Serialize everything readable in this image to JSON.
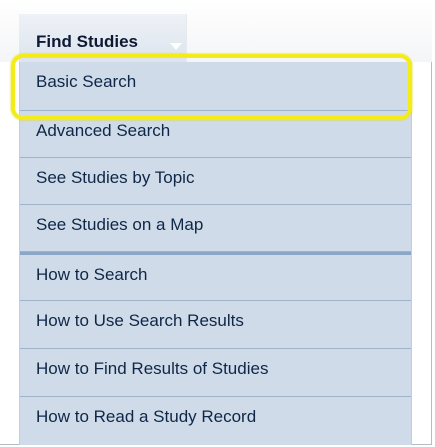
{
  "tab": {
    "label": "Find Studies"
  },
  "menu": {
    "items": [
      {
        "label": "Basic Search"
      },
      {
        "label": "Advanced Search"
      },
      {
        "label": "See Studies by Topic"
      },
      {
        "label": "See Studies on a Map"
      },
      {
        "label": "How to Search"
      },
      {
        "label": "How to Use Search Results"
      },
      {
        "label": "How to Find Results of Studies"
      },
      {
        "label": "How to Read a Study Record"
      }
    ]
  },
  "colors": {
    "menu_background": "#cfdbe9",
    "menu_text": "#0f2746",
    "highlight": "#f3ec19"
  }
}
